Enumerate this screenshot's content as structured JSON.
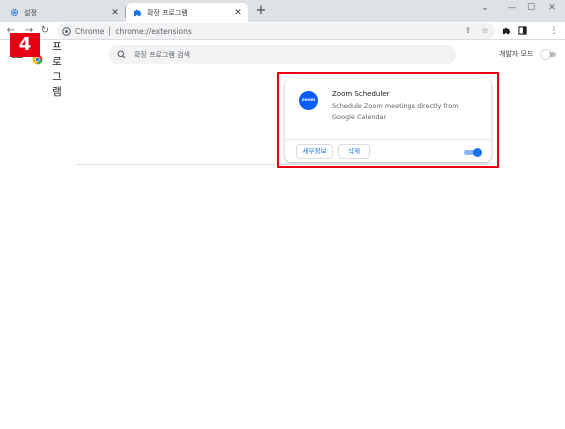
{
  "browser": {
    "tabs": [
      {
        "title": "설정",
        "icon": "gear-icon",
        "active": false
      },
      {
        "title": "확장 프로그램",
        "icon": "puzzle-icon",
        "active": true
      }
    ],
    "new_tab_label": "+",
    "address_bar": {
      "chip": "Chrome",
      "url": "chrome://extensions"
    }
  },
  "page": {
    "title_chars": [
      "프",
      "로",
      "그",
      "램"
    ],
    "search_placeholder": "확장 프로그램 검색",
    "developer_mode_label": "개발자 모드",
    "developer_mode_on": false
  },
  "extension": {
    "name": "Zoom Scheduler",
    "description": "Schedule Zoom meetings directly from Google Calendar",
    "icon_text": "zoom",
    "details_button": "세부정보",
    "remove_button": "삭제",
    "enabled": true
  },
  "annotation": {
    "step_number": "4"
  },
  "colors": {
    "accent_blue": "#1a73e8",
    "zoom_blue": "#0b5cff",
    "annotation_red": "#e60012",
    "tabstrip_bg": "#dee1e6"
  }
}
